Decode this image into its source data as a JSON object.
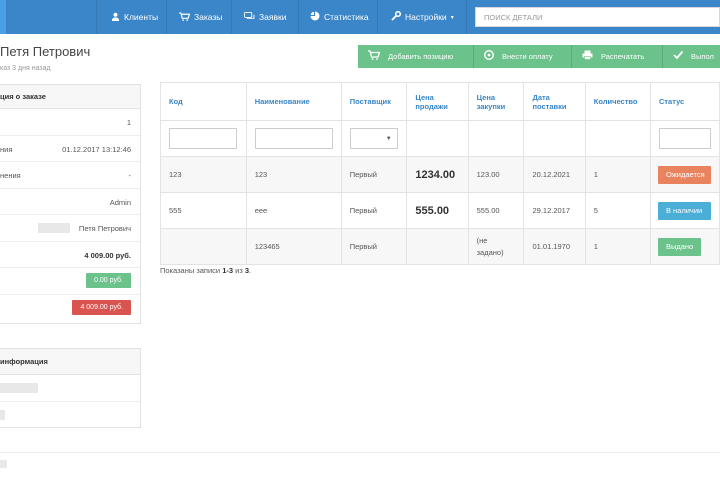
{
  "nav": {
    "items": [
      {
        "label": "Клиенты",
        "icon": "user-icon"
      },
      {
        "label": "Заказы",
        "icon": "cart-icon"
      },
      {
        "label": "Заявки",
        "icon": "chat-icon"
      },
      {
        "label": "Статистика",
        "icon": "pie-chart-icon"
      },
      {
        "label": "Настройки",
        "icon": "wrench-icon"
      }
    ],
    "settings_caret": "▾",
    "search_placeholder": "ПОИСК ДЕТАЛИ"
  },
  "header": {
    "title": "Петя Петрович",
    "subtitle": "каз 3 дня назад"
  },
  "actions": [
    {
      "label": "Добавить позицию",
      "icon": "cart-add-icon"
    },
    {
      "label": "Внести оплату",
      "icon": "coin-icon"
    },
    {
      "label": "Распечатать",
      "icon": "printer-icon"
    },
    {
      "label": "Выпол",
      "icon": "check-icon"
    }
  ],
  "order_panel": {
    "title": "ция о заказе",
    "rows": [
      {
        "label": "",
        "value": "1"
      },
      {
        "label": "ния",
        "value": "01.12.2017 13:12:46"
      },
      {
        "label": "нения",
        "value": "-"
      },
      {
        "label": "",
        "value": "Admin"
      },
      {
        "label": "",
        "value": "Петя Петрович"
      },
      {
        "label": "",
        "value": "4 009.00 руб."
      },
      {
        "label": "",
        "value": "0.00 руб."
      },
      {
        "label": "",
        "value": "4 009.00 руб."
      }
    ]
  },
  "info_panel": {
    "title": "информация"
  },
  "table": {
    "headers": [
      "Код",
      "Наименование",
      "Поставщик",
      "Цена продажи",
      "Цена закупки",
      "Дата поставки",
      "Количество",
      "Статус"
    ],
    "select_caret": "▼",
    "rows": [
      {
        "code": "123",
        "name": "123",
        "supplier": "Первый",
        "sale": "1234.00",
        "purchase": "123.00",
        "date": "20.12.2021",
        "qty": "1",
        "status": "Ожидается"
      },
      {
        "code": "555",
        "name": "eee",
        "supplier": "Первый",
        "sale": "555.00",
        "purchase": "555.00",
        "date": "29.12.2017",
        "qty": "5",
        "status": "В наличии"
      },
      {
        "code": "",
        "name": "123465",
        "supplier": "Первый",
        "sale": "",
        "purchase": "(не задано)",
        "date": "01.01.1970",
        "qty": "1",
        "status": "Выдано"
      }
    ],
    "shown_prefix": "Показаны записи ",
    "shown_range": "1-3",
    "shown_middle": " из ",
    "shown_total": "3",
    "shown_suffix": "."
  },
  "colors": {
    "navbar": "#3a86c8",
    "action_green": "#6bc28a",
    "status_orange": "#e8835e",
    "status_blue": "#4aaed6",
    "status_green": "#6bc28a",
    "badge_red": "#d9534f"
  }
}
